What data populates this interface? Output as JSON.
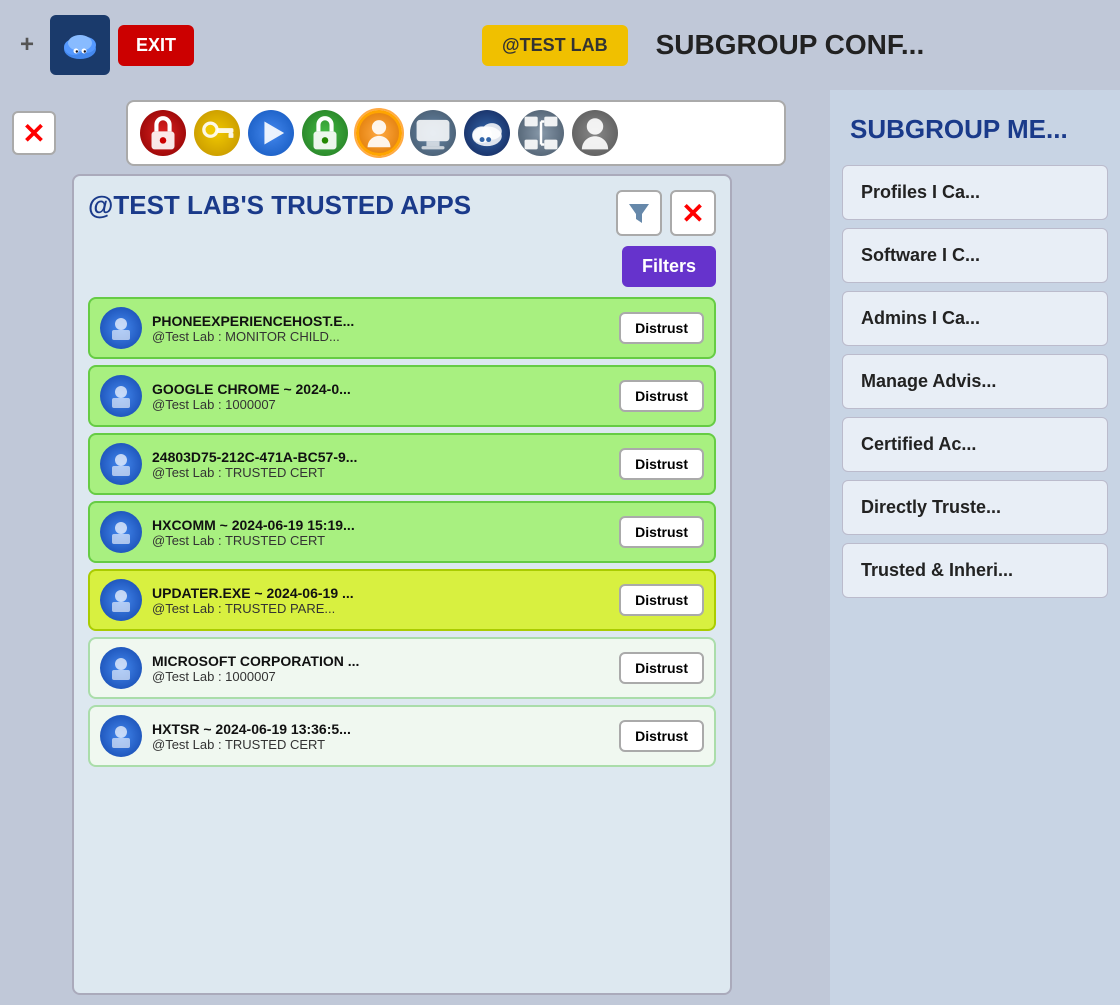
{
  "topbar": {
    "plus_label": "+",
    "exit_label": "EXIT",
    "test_lab_label": "@TEST LAB",
    "subgroup_conf_label": "SUBGROUP CONF..."
  },
  "toolbar": {
    "icons": [
      {
        "name": "red-lock-icon",
        "class": "red-lock",
        "symbol": "🔒"
      },
      {
        "name": "yellow-key-icon",
        "class": "yellow-key",
        "symbol": "🔑"
      },
      {
        "name": "blue-play-icon",
        "class": "blue-play",
        "symbol": "▶"
      },
      {
        "name": "green-lock-icon",
        "class": "green-lock",
        "symbol": "🔒"
      },
      {
        "name": "orange-person-icon",
        "class": "orange-person",
        "symbol": "👤"
      },
      {
        "name": "gray-monitor-icon",
        "class": "gray-monitor",
        "symbol": "🖥"
      },
      {
        "name": "blue-cloud-icon",
        "class": "blue-cloud",
        "symbol": "☁"
      },
      {
        "name": "grid-icon",
        "class": "grid-icon",
        "symbol": "⊞"
      },
      {
        "name": "person-silhouette-icon",
        "class": "person-icon",
        "symbol": "👤"
      }
    ]
  },
  "panel": {
    "title": "@TEST LAB'S TRUSTED APPS",
    "filters_label": "Filters",
    "apps": [
      {
        "name": "PHONEEXPERIENCEHOST.E...",
        "sub": "@Test Lab : MONITOR CHILD...",
        "color": "green",
        "distrust": "Distrust"
      },
      {
        "name": "GOOGLE CHROME  ~ 2024-0...",
        "sub": "@Test Lab : 1000007",
        "color": "green",
        "distrust": "Distrust"
      },
      {
        "name": "24803D75-212C-471A-BC57-9...",
        "sub": "@Test Lab : TRUSTED CERT",
        "color": "green",
        "distrust": "Distrust"
      },
      {
        "name": "HXCOMM  ~ 2024-06-19 15:19...",
        "sub": "@Test Lab : TRUSTED CERT",
        "color": "green",
        "distrust": "Distrust"
      },
      {
        "name": "UPDATER.EXE  ~ 2024-06-19 ...",
        "sub": "@Test Lab : TRUSTED PARE...",
        "color": "yellow-green",
        "distrust": "Distrust"
      },
      {
        "name": "MICROSOFT CORPORATION ...",
        "sub": "@Test Lab : 1000007",
        "color": "white",
        "distrust": "Distrust"
      },
      {
        "name": "HXTSR  ~ 2024-06-19 13:36:5...",
        "sub": "@Test Lab : TRUSTED CERT",
        "color": "white",
        "distrust": "Distrust"
      }
    ]
  },
  "right": {
    "title": "SUBGROUP ME...",
    "menu_items": [
      "Profiles I Ca...",
      "Software I C...",
      "Admins I Ca...",
      "Manage Advis...",
      "Certified Ac...",
      "Directly Truste...",
      "Trusted & Inheri..."
    ]
  }
}
